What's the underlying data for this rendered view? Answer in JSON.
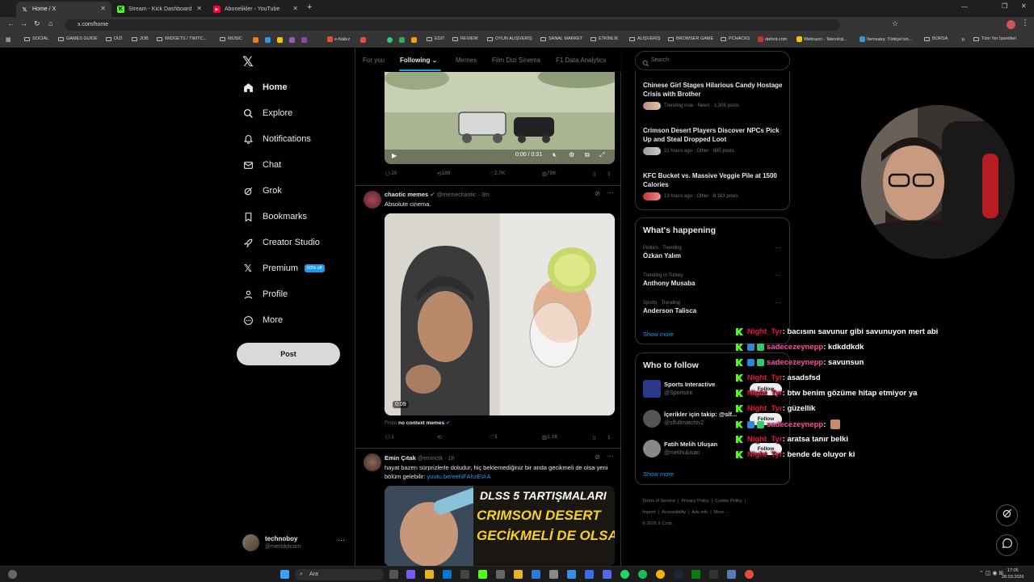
{
  "browser": {
    "tabs": [
      {
        "title": "Home / X",
        "favicon": "x-logo"
      },
      {
        "title": "Stream - Kick Dashboard",
        "favicon": "kick-logo"
      },
      {
        "title": "Abonelikler - YouTube",
        "favicon": "youtube-logo"
      }
    ],
    "url": "x.com/home",
    "bookmarks": [
      "SOCIAL",
      "GAMES GUIDE",
      "DİZİ",
      "JOB",
      "WIDGETS / TWITC...",
      "MUSIC",
      "e-Nabız",
      "EDIT",
      "REVIEW",
      "OYUN ALIŞVERİŞ",
      "SANAL MARKET",
      "ETKİNLİK",
      "ALIŞVERİŞ",
      "BROWSER GAME",
      "PCHACKS",
      "dafont.com",
      "Webrazzi - Teknoloji...",
      "İtemsatış: Türkiye'nin...",
      "BORSA",
      "Tüm Yer İşaretleri"
    ]
  },
  "sidebar": {
    "items": [
      {
        "label": "Home",
        "icon": "home-icon"
      },
      {
        "label": "Explore",
        "icon": "search-icon"
      },
      {
        "label": "Notifications",
        "icon": "bell-icon"
      },
      {
        "label": "Chat",
        "icon": "mail-icon"
      },
      {
        "label": "Grok",
        "icon": "grok-icon"
      },
      {
        "label": "Bookmarks",
        "icon": "bookmark-icon"
      },
      {
        "label": "Creator Studio",
        "icon": "rocket-icon"
      },
      {
        "label": "Premium",
        "icon": "x-icon",
        "badge": "50% off"
      },
      {
        "label": "Profile",
        "icon": "person-icon"
      },
      {
        "label": "More",
        "icon": "more-circle-icon"
      }
    ],
    "post_label": "Post",
    "account": {
      "name": "technoboy",
      "handle": "@mertdotcom"
    }
  },
  "feed": {
    "tabs": [
      "For you",
      "Following",
      "Memes",
      "Film Dizi Sinema",
      "F1 Data Analytics"
    ],
    "video1": {
      "time": "0:00 / 0:31",
      "replies": "20",
      "reposts": "189",
      "likes": "2.7K",
      "views": "78K"
    },
    "post2": {
      "name": "chaotic memes",
      "handle": "@memechaotic",
      "time": "3m",
      "text": "Absolute cinema.",
      "video_time": "0:09",
      "from_prefix": "From",
      "from_name": "no context memes",
      "replies": "1",
      "reposts": "",
      "likes": "3",
      "views": "1.1K"
    },
    "post3": {
      "name": "Emin Çıtak",
      "handle": "@eminctk",
      "time": "1h",
      "text": "hayat bazen sürprizlerle doludur, hiç beklemediğiniz bir anda gecikmeli de olsa yeni bölüm gelebilir: ",
      "link": "youtu.be/eeNFAhzEVrA",
      "thumb_line1": "DLSS 5 TARTIŞMALARI",
      "thumb_line2": "CRIMSON DESERT",
      "thumb_line3": "GECİKMELİ DE OLSA"
    }
  },
  "right": {
    "search_placeholder": "Search",
    "news": [
      {
        "title": "Chinese Girl Stages Hilarious Candy Hostage Crisis with Brother",
        "meta": "Trending now · News · 1,306 posts"
      },
      {
        "title": "Crimson Desert Players Discover NPCs Pick Up and Steal Dropped Loot",
        "meta": "21 hours ago · Other · 895 posts"
      },
      {
        "title": "KFC Bucket vs. Massive Veggie Pile at 1500 Calories",
        "meta": "19 hours ago · Other · 8,163 posts"
      }
    ],
    "whats_happening_title": "What's happening",
    "trends": [
      {
        "context": "Politics · Trending",
        "name": "Özkan Yalım"
      },
      {
        "context": "Trending in Turkey",
        "name": "Anthony Musaba"
      },
      {
        "context": "Sports · Trending",
        "name": "Anderson Talisca"
      }
    ],
    "show_more": "Show more",
    "who_to_follow_title": "Who to follow",
    "follow": [
      {
        "name": "Sports Interactive",
        "handle": "@SportsInt"
      },
      {
        "name": "İçerikler için takip: @slf...",
        "handle": "@slfullmatchtv2"
      },
      {
        "name": "Fatih Melih Uluşan",
        "handle": "@melihulusan"
      }
    ],
    "follow_label": "Follow",
    "footer": [
      "Terms of Service",
      "Privacy Policy",
      "Cookie Policy",
      "Imprint",
      "Accessibility",
      "Ads info",
      "More ···",
      "© 2026 X Corp."
    ]
  },
  "chat": [
    {
      "user": "Night_Tyr",
      "msg": ": bacısını savunur gibi savunuyon mert abi",
      "type": 1
    },
    {
      "user": "sadecezeynepp",
      "msg": ": kdkddkdk",
      "type": 2
    },
    {
      "user": "sadecezeynepp",
      "msg": ": savunsun",
      "type": 2
    },
    {
      "user": "Night_Tyr",
      "msg": ": asadsfsd",
      "type": 1
    },
    {
      "user": "Night_Tyr",
      "msg": ": btw benim gözüme hitap etmiyor ya",
      "type": 1
    },
    {
      "user": "Night_Tyr",
      "msg": ": güzellik",
      "type": 1
    },
    {
      "user": "sadecezeynepp",
      "msg": ":",
      "type": 2
    },
    {
      "user": "Night_Tyr",
      "msg": ": aratsa tanır belki",
      "type": 1
    },
    {
      "user": "Night_Tyr",
      "msg": ": bende de oluyor ki",
      "type": 1
    }
  ],
  "taskbar": {
    "search": "Ara",
    "time": "17:05",
    "date": "28.03.2026"
  }
}
